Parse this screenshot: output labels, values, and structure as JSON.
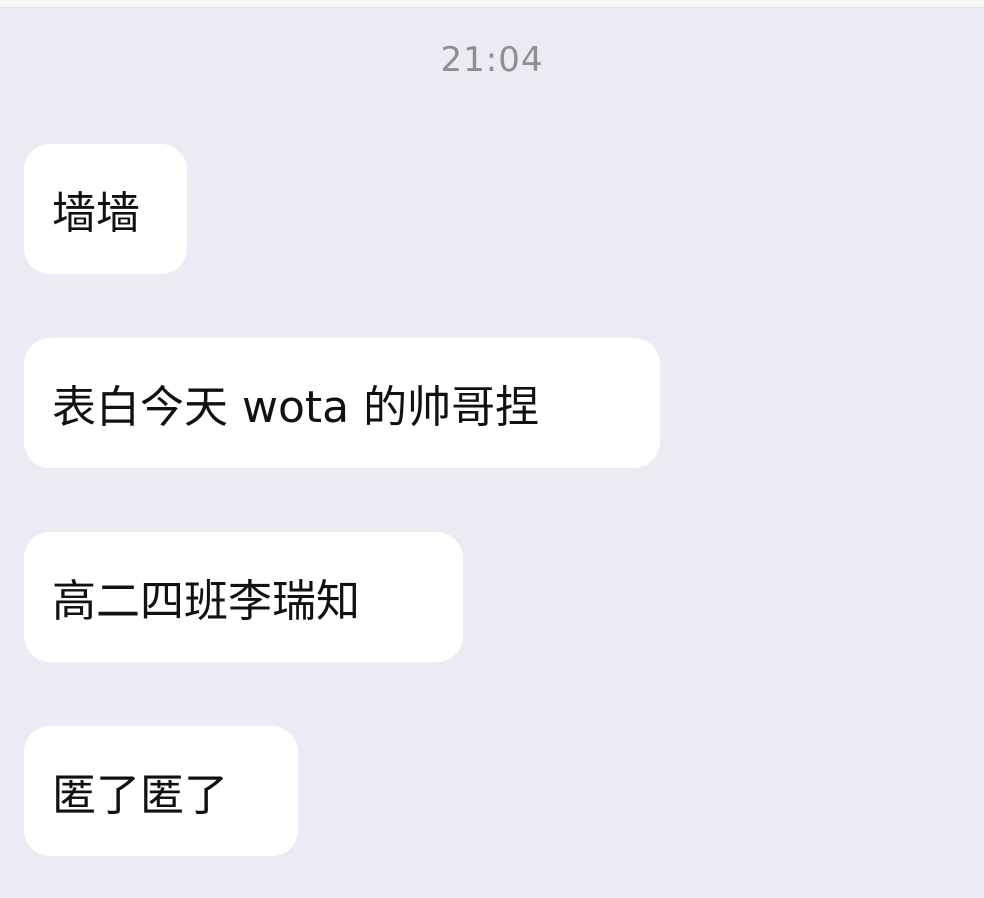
{
  "chat": {
    "timestamp": "21:04",
    "messages": [
      {
        "text": "墙墙"
      },
      {
        "text": "表白今天 wota 的帅哥捏"
      },
      {
        "text": "高二四班李瑞知"
      },
      {
        "text": "匿了匿了"
      }
    ]
  },
  "colors": {
    "background": "#ebebf4",
    "bubble": "#ffffff",
    "text": "#111111",
    "timestamp": "#8e8e93"
  }
}
